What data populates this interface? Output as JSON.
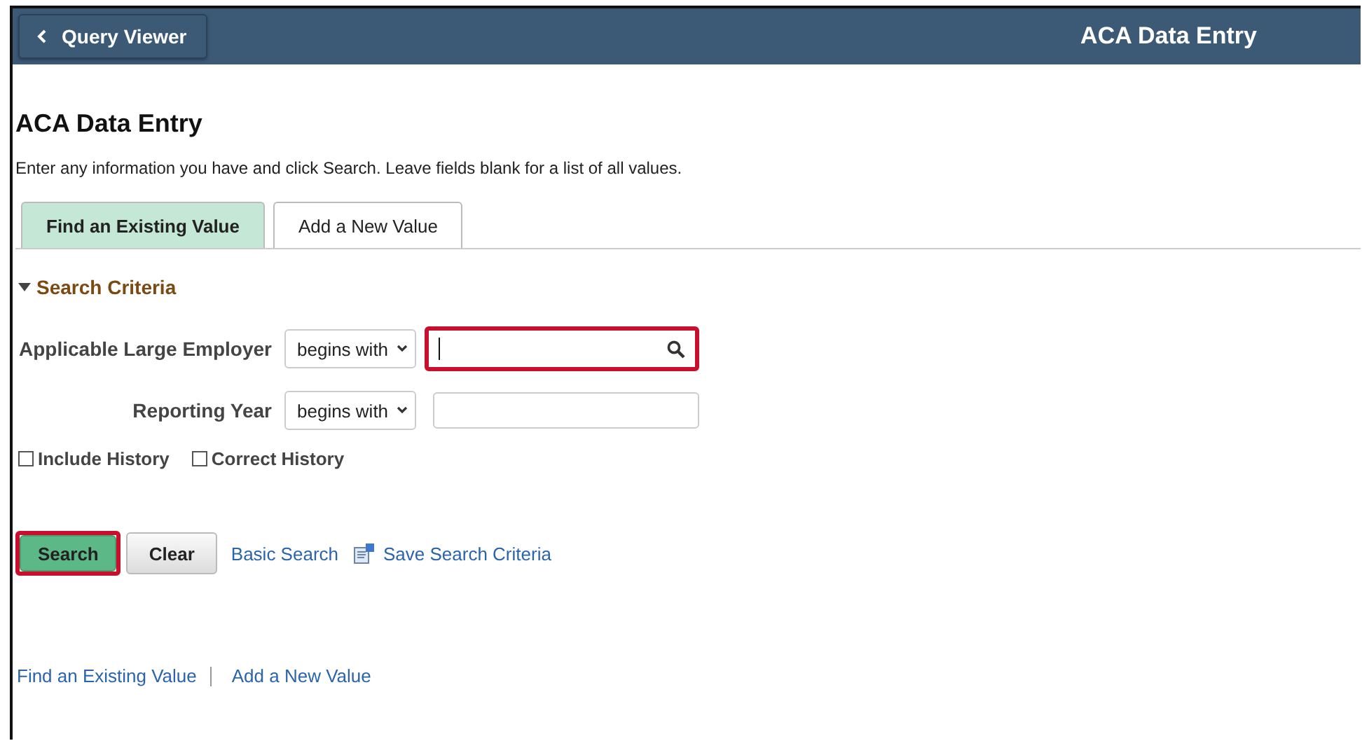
{
  "header": {
    "back_button": "Query Viewer",
    "title": "ACA Data Entry"
  },
  "page": {
    "title": "ACA Data Entry",
    "instructions": "Enter any information you have and click Search. Leave fields blank for a list of all values."
  },
  "tabs": [
    {
      "label": "Find an Existing Value",
      "selected": true
    },
    {
      "label": "Add a New Value",
      "selected": false
    }
  ],
  "section": {
    "title": "Search Criteria",
    "expanded": true
  },
  "fields": [
    {
      "label": "Applicable Large Employer",
      "operator": "begins with",
      "lookup": true,
      "highlighted": true
    },
    {
      "label": "Reporting Year",
      "operator": "begins with",
      "lookup": false,
      "highlighted": false
    }
  ],
  "checkboxes": [
    {
      "label": "Include History",
      "checked": false
    },
    {
      "label": "Correct History",
      "checked": false
    }
  ],
  "actions": [
    {
      "kind": "primary",
      "label": "Search",
      "highlighted": true
    },
    {
      "kind": "button",
      "label": "Clear",
      "highlighted": false
    },
    {
      "kind": "link",
      "label": "Basic Search",
      "highlighted": false
    },
    {
      "kind": "icon-link",
      "label": "Save Search Criteria",
      "highlighted": false
    }
  ],
  "footer_links": [
    "Find an Existing Value",
    "Add a New Value"
  ]
}
